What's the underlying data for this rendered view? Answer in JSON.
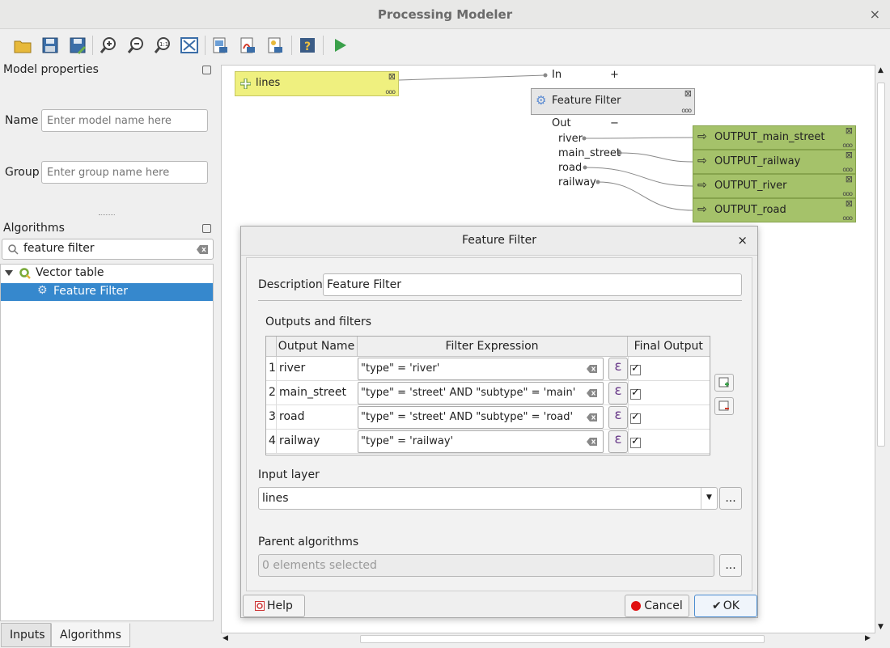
{
  "window": {
    "title": "Processing Modeler",
    "close_glyph": "×"
  },
  "toolbar": {
    "icons": [
      "open-model-icon",
      "save-model-icon",
      "save-as-icon",
      "zoom-in-icon",
      "zoom-out-icon",
      "zoom-actual-icon",
      "zoom-full-icon",
      "export-image-icon",
      "export-pdf-icon",
      "export-svg-icon",
      "edit-help-icon",
      "run-model-icon"
    ]
  },
  "model_properties": {
    "title": "Model properties",
    "name_label": "Name",
    "name_placeholder": "Enter model name here",
    "group_label": "Group",
    "group_placeholder": "Enter group name here"
  },
  "algorithms": {
    "title": "Algorithms",
    "search_value": "feature filter",
    "tree": {
      "group": "Vector table",
      "item": "Feature Filter"
    }
  },
  "bottom_tabs": {
    "inputs": "Inputs",
    "algorithms": "Algorithms"
  },
  "canvas": {
    "input_node": "lines",
    "algorithm_node": "Feature Filter",
    "in_label": "In",
    "in_toggle": "+",
    "out_label": "Out",
    "out_toggle": "−",
    "ports": [
      "river",
      "main_street",
      "road",
      "railway"
    ],
    "outputs": [
      "OUTPUT_main_street",
      "OUTPUT_railway",
      "OUTPUT_river",
      "OUTPUT_road"
    ],
    "output_color": "#a5c26a",
    "input_color": "#eff07f"
  },
  "dialog": {
    "title": "Feature Filter",
    "close_glyph": "×",
    "description_label": "Description",
    "description_value": "Feature Filter",
    "outputs_label": "Outputs and filters",
    "headers": {
      "name": "Output Name",
      "expr": "Filter Expression",
      "final": "Final Output"
    },
    "rows": [
      {
        "num": "1",
        "name": "river",
        "expr": "\"type\" = 'river'",
        "final": true
      },
      {
        "num": "2",
        "name": "main_street",
        "expr": "\"type\" = 'street' AND \"subtype\" = 'main'",
        "final": true
      },
      {
        "num": "3",
        "name": "road",
        "expr": "\"type\" = 'street' AND \"subtype\" = 'road'",
        "final": true
      },
      {
        "num": "4",
        "name": "railway",
        "expr": "\"type\" = 'railway'",
        "final": true
      }
    ],
    "expr_glyph": "ε",
    "input_layer_label": "Input layer",
    "input_layer_value": "lines",
    "browse_label": "...",
    "parent_label": "Parent algorithms",
    "parent_value": "0 elements selected",
    "help_label": "Help",
    "cancel_label": "Cancel",
    "ok_label": "OK"
  }
}
